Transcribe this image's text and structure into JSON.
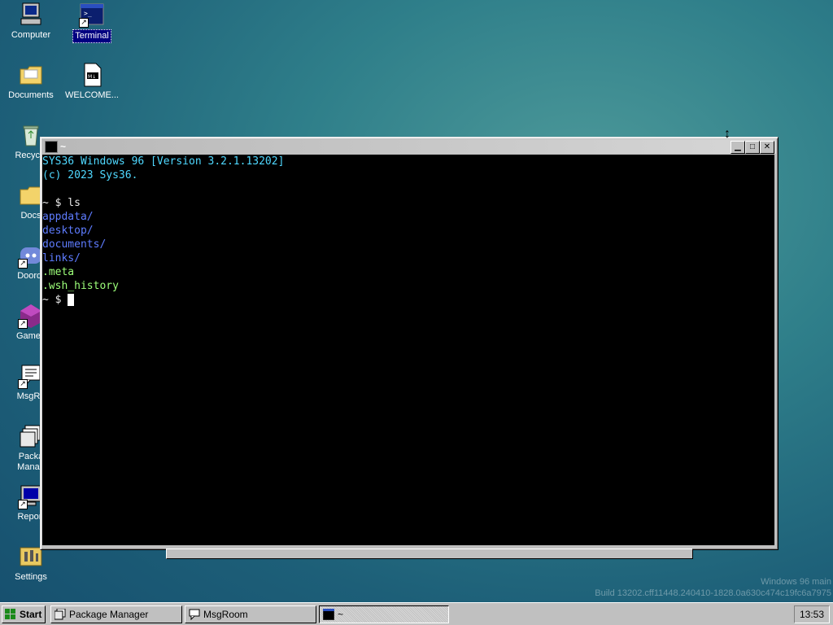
{
  "desktop": {
    "icons": [
      {
        "label": "Computer"
      },
      {
        "label": "Terminal"
      },
      {
        "label": "Documents"
      },
      {
        "label": "WELCOME..."
      },
      {
        "label": "Recycle"
      },
      {
        "label": "Docs"
      },
      {
        "label": "Doordr"
      },
      {
        "label": "Gamen"
      },
      {
        "label": "MsgRo"
      },
      {
        "label": "Packa Manag"
      },
      {
        "label": "Report"
      },
      {
        "label": "Settings"
      }
    ]
  },
  "terminal": {
    "title": "~",
    "lines": [
      {
        "text": "SYS36 Windows 96 [Version 3.2.1.13202]",
        "color": "#4fd8ff"
      },
      {
        "text": "(c) 2023 Sys36.",
        "color": "#4fd8ff"
      },
      {
        "text": "",
        "color": "#e8e8e8"
      },
      {
        "text": "~ $ ls",
        "color": "#e8e8e8"
      },
      {
        "text": "appdata/",
        "color": "#5e7cff"
      },
      {
        "text": "desktop/",
        "color": "#5e7cff"
      },
      {
        "text": "documents/",
        "color": "#5e7cff"
      },
      {
        "text": "links/",
        "color": "#5e7cff"
      },
      {
        "text": ".meta",
        "color": "#9dff7a"
      },
      {
        "text": ".wsh_history",
        "color": "#9dff7a"
      }
    ],
    "prompt": "~ $ "
  },
  "watermark": {
    "line1": "Windows 96 main",
    "line2": "Build 13202.cff11448.240410-1828.0a630c474c19fc6a7975"
  },
  "taskbar": {
    "start_label": "Start",
    "tasks": [
      {
        "label": "Package Manager"
      },
      {
        "label": "MsgRoom"
      },
      {
        "label": "~"
      }
    ],
    "clock": "13:53"
  }
}
